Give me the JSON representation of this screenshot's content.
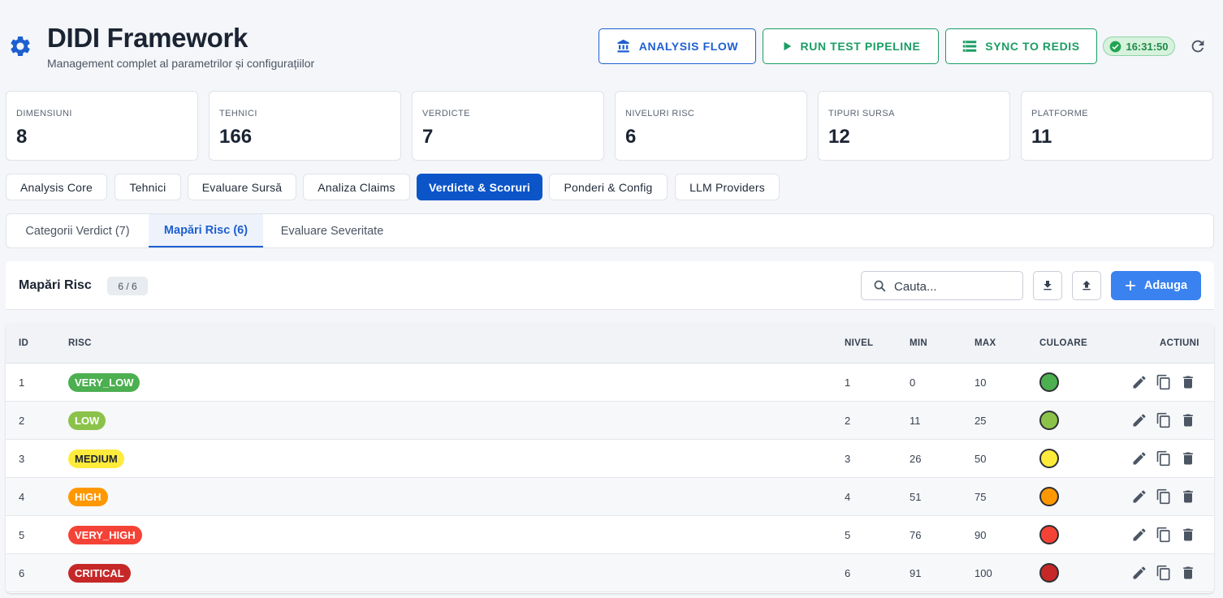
{
  "header": {
    "title": "DIDI Framework",
    "subtitle": "Management complet al parametrilor și configurațiilor",
    "buttons": {
      "analysis_flow": "ANALYSIS FLOW",
      "run_test": "RUN TEST PIPELINE",
      "sync": "SYNC TO REDIS"
    },
    "time": "16:31:50"
  },
  "stats": [
    {
      "label": "DIMENSIUNI",
      "value": "8"
    },
    {
      "label": "TEHNICI",
      "value": "166"
    },
    {
      "label": "VERDICTE",
      "value": "7"
    },
    {
      "label": "NIVELURI RISC",
      "value": "6"
    },
    {
      "label": "TIPURI SURSA",
      "value": "12"
    },
    {
      "label": "PLATFORME",
      "value": "11"
    }
  ],
  "main_tabs": [
    "Analysis Core",
    "Tehnici",
    "Evaluare Sursă",
    "Analiza Claims",
    "Verdicte & Scoruri",
    "Ponderi & Config",
    "LLM Providers"
  ],
  "sub_tabs": [
    "Categorii Verdict (7)",
    "Mapări Risc (6)",
    "Evaluare Severitate"
  ],
  "toolbar": {
    "title": "Mapări Risc",
    "count": "6 / 6",
    "search_placeholder": "Cauta...",
    "add_label": "Adauga"
  },
  "table": {
    "headers": {
      "id": "ID",
      "risc": "RISC",
      "nivel": "NIVEL",
      "min": "MIN",
      "max": "MAX",
      "culoare": "CULOARE",
      "actiuni": "ACTIUNI"
    },
    "rows": [
      {
        "id": "1",
        "risc": "VERY_LOW",
        "nivel": "1",
        "min": "0",
        "max": "10",
        "color": "#4caf50",
        "text_color": "#ffffff"
      },
      {
        "id": "2",
        "risc": "LOW",
        "nivel": "2",
        "min": "11",
        "max": "25",
        "color": "#8bc34a",
        "text_color": "#ffffff"
      },
      {
        "id": "3",
        "risc": "MEDIUM",
        "nivel": "3",
        "min": "26",
        "max": "50",
        "color": "#ffeb3b",
        "text_color": "#1b2433"
      },
      {
        "id": "4",
        "risc": "HIGH",
        "nivel": "4",
        "min": "51",
        "max": "75",
        "color": "#ff9800",
        "text_color": "#ffffff"
      },
      {
        "id": "5",
        "risc": "VERY_HIGH",
        "nivel": "5",
        "min": "76",
        "max": "90",
        "color": "#f44336",
        "text_color": "#ffffff"
      },
      {
        "id": "6",
        "risc": "CRITICAL",
        "nivel": "6",
        "min": "91",
        "max": "100",
        "color": "#c62828",
        "text_color": "#ffffff"
      }
    ]
  },
  "colors": {
    "primary": "#0b55c9",
    "accent_blue": "#1d5fd0",
    "accent_green": "#1a9e64",
    "add_button": "#3a82f0"
  },
  "icons": {
    "header": "gear-icon",
    "analysis_flow": "bank-icon",
    "run_test": "play-icon",
    "sync": "list-icon",
    "time": "check-circle-icon",
    "refresh": "refresh-icon",
    "search": "search-icon",
    "download": "download-icon",
    "upload": "upload-icon",
    "add": "plus-icon",
    "row_actions": [
      "edit-icon",
      "copy-icon",
      "delete-icon"
    ]
  }
}
